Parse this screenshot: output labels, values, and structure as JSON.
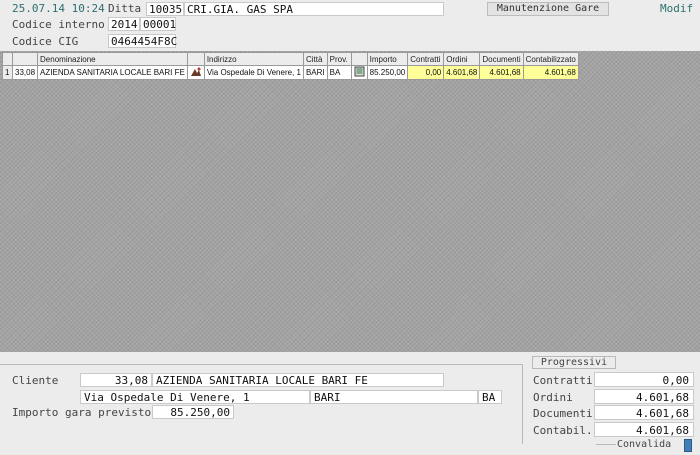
{
  "header": {
    "datetime": "25.07.14 10:24",
    "ditta_label": "Ditta",
    "ditta_code": "10035",
    "ditta_name": "CRI.GIA. GAS SPA",
    "maint_button": "Manutenzione Gare",
    "mode": "Modif",
    "codice_interno_label": "Codice interno",
    "codice_interno_year": "2014",
    "codice_interno_num": "00001",
    "codice_cig_label": "Codice CIG",
    "codice_cig_value": "0464454F8C"
  },
  "grid": {
    "columns": [
      "",
      "",
      "Denominazione",
      "",
      "Indirizzo",
      "Città",
      "Prov.",
      "",
      "Importo",
      "Contratti",
      "Ordini",
      "Documenti",
      "Contabilizzato"
    ],
    "rows": [
      {
        "n": "1",
        "code": "33,08",
        "denominazione": "AZIENDA SANITARIA LOCALE BARI FE",
        "indirizzo": "Via Ospedale Di Venere, 1",
        "citta": "BARI",
        "prov": "BA",
        "importo": "85.250,00",
        "contratti": "0,00",
        "ordini": "4.601,68",
        "documenti": "4.601,68",
        "contabilizzato": "4.601,68"
      }
    ]
  },
  "detail": {
    "cliente_label": "Cliente",
    "cliente_code": "33,08",
    "cliente_name": "AZIENDA SANITARIA LOCALE BARI FE",
    "address": "Via Ospedale Di Venere, 1",
    "city": "BARI",
    "prov": "BA",
    "importo_label": "Importo gara previsto",
    "importo_value": "85.250,00"
  },
  "progressivi": {
    "title": "Progressivi",
    "contratti_label": "Contratti",
    "contratti_value": "0,00",
    "ordini_label": "Ordini",
    "ordini_value": "4.601,68",
    "documenti_label": "Documenti",
    "documenti_value": "4.601,68",
    "contabil_label": "Contabil.",
    "contabil_value": "4.601,68",
    "convalida_label": "Convalida"
  }
}
